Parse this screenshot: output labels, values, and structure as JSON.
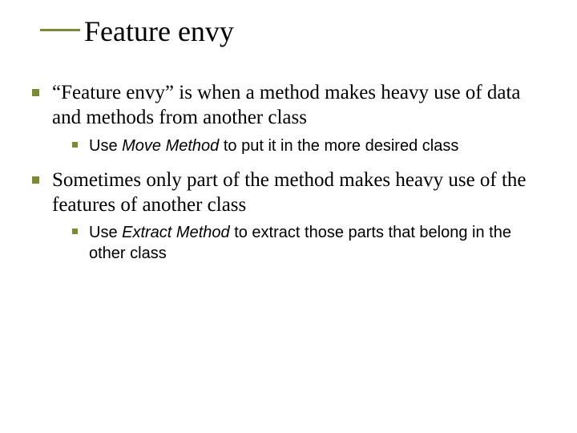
{
  "title": "Feature envy",
  "bullets": {
    "item1": {
      "text": "“Feature envy” is when a method makes heavy use of data and methods from another class",
      "sub": {
        "prefix": "Use ",
        "ital": "Move Method",
        "suffix": " to put it in the more desired class"
      }
    },
    "item2": {
      "text": "Sometimes only part of the method makes heavy use of the features of another class",
      "sub": {
        "prefix": "Use ",
        "ital": "Extract Method",
        "suffix": " to extract those parts that belong in the other class"
      }
    }
  }
}
